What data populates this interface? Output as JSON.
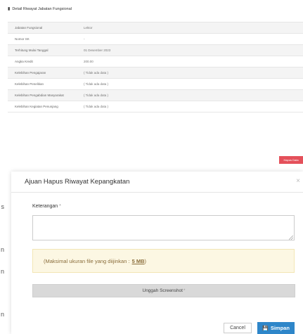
{
  "background": {
    "title": "Detail Riwayat Jabatan Fungsional",
    "rows": [
      {
        "label": "Jabatan Fungsional",
        "value": "Lektor"
      },
      {
        "label": "Nomor SK",
        "value": "-"
      },
      {
        "label": "Terhitung Mulai Tanggal",
        "value": "01 Desember 2023"
      },
      {
        "label": "Angka Kredit",
        "value": "200.00"
      },
      {
        "label": "Kelebihan Pengajaran",
        "value": "( Tidak ada data )"
      },
      {
        "label": "Kelebihan Penelitian",
        "value": "( Tidak ada data )"
      },
      {
        "label": "Kelebihan Pengabdian Masyarakat",
        "value": "( Tidak ada data )"
      },
      {
        "label": "Kelebihan Kegiatan Penunjang",
        "value": "( Tidak ada data )"
      }
    ],
    "hapus_label": "Hapus Data",
    "side_letters": [
      "s",
      "n",
      "n",
      "n"
    ]
  },
  "modal": {
    "title": "Ajuan Hapus Riwayat Kepangkatan",
    "close": "×",
    "keterangan_label": "Keterangan",
    "required_mark": "*",
    "keterangan_value": "",
    "info_text": "(Maksimal ukuran file yang diijinkan :",
    "info_size": "5 MB",
    "info_close": ")",
    "upload_label": "Unggah Screenshot",
    "cancel_label": "Cancel",
    "save_label": "Simpan"
  },
  "icons": {
    "book": "book-icon",
    "save": "save-icon"
  },
  "colors": {
    "primary": "#2e86c9",
    "danger": "#e4505a",
    "warning_bg": "#fcf7e3",
    "warning_text": "#8a6d3b"
  }
}
